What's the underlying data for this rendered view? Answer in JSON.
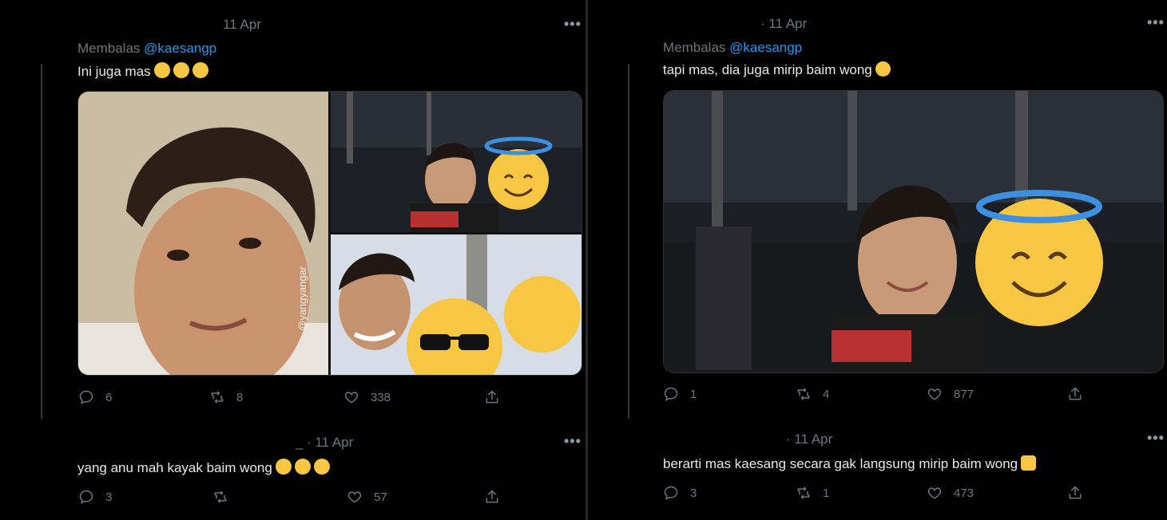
{
  "left": {
    "tweet1": {
      "date": "11 Apr",
      "replying_prefix": "Membalas",
      "replying_handle": "@kaesangp",
      "text": "Ini juga mas",
      "emojis": [
        "joy",
        "joy",
        "joy"
      ],
      "watermark": "@yangyangar",
      "actions": {
        "replies": "6",
        "retweets": "8",
        "likes": "338"
      }
    },
    "tweet2": {
      "name_fragment": "_",
      "date": "· 11 Apr",
      "text": "yang anu mah kayak baim wong",
      "emojis": [
        "pensive",
        "pensive",
        "pensive"
      ],
      "actions": {
        "replies": "3",
        "retweets": "",
        "likes": "57"
      }
    }
  },
  "right": {
    "tweet1": {
      "date": "· 11 Apr",
      "replying_prefix": "Membalas",
      "replying_handle": "@kaesangp",
      "text": "tapi mas, dia juga mirip baim wong",
      "emojis": [
        "thinking"
      ],
      "actions": {
        "replies": "1",
        "retweets": "4",
        "likes": "877"
      }
    },
    "tweet2": {
      "date": "· 11 Apr",
      "text": "berarti mas kaesang secara gak langsung mirip baim wong",
      "emojis": [
        "folded-hands"
      ],
      "actions": {
        "replies": "3",
        "retweets": "1",
        "likes": "473"
      }
    }
  },
  "more_label": "•••",
  "colors": {
    "background": "#000000",
    "link": "#1d9bf0",
    "muted": "#6e767d",
    "text": "#e7e9ea",
    "emoji": "#f7c744"
  }
}
